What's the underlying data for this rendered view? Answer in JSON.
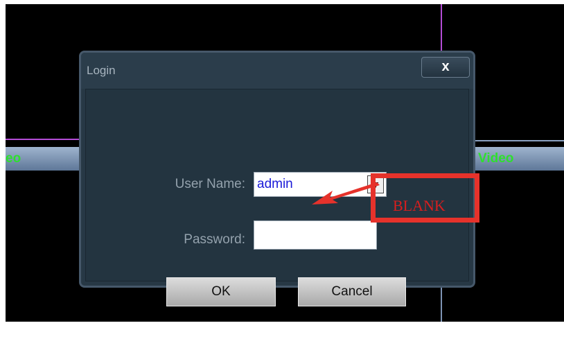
{
  "background": {
    "video_left_label": "eo",
    "video_right_label": "Video",
    "video_label_color": "#2ee02e"
  },
  "dialog": {
    "title": "Login",
    "close_label": "x",
    "user_name_label": "User Name:",
    "user_name_value": "admin",
    "password_label": "Password:",
    "password_value": "",
    "ok_label": "OK",
    "cancel_label": "Cancel"
  },
  "annotation": {
    "text": "BLANK",
    "color": "#e6322b"
  }
}
